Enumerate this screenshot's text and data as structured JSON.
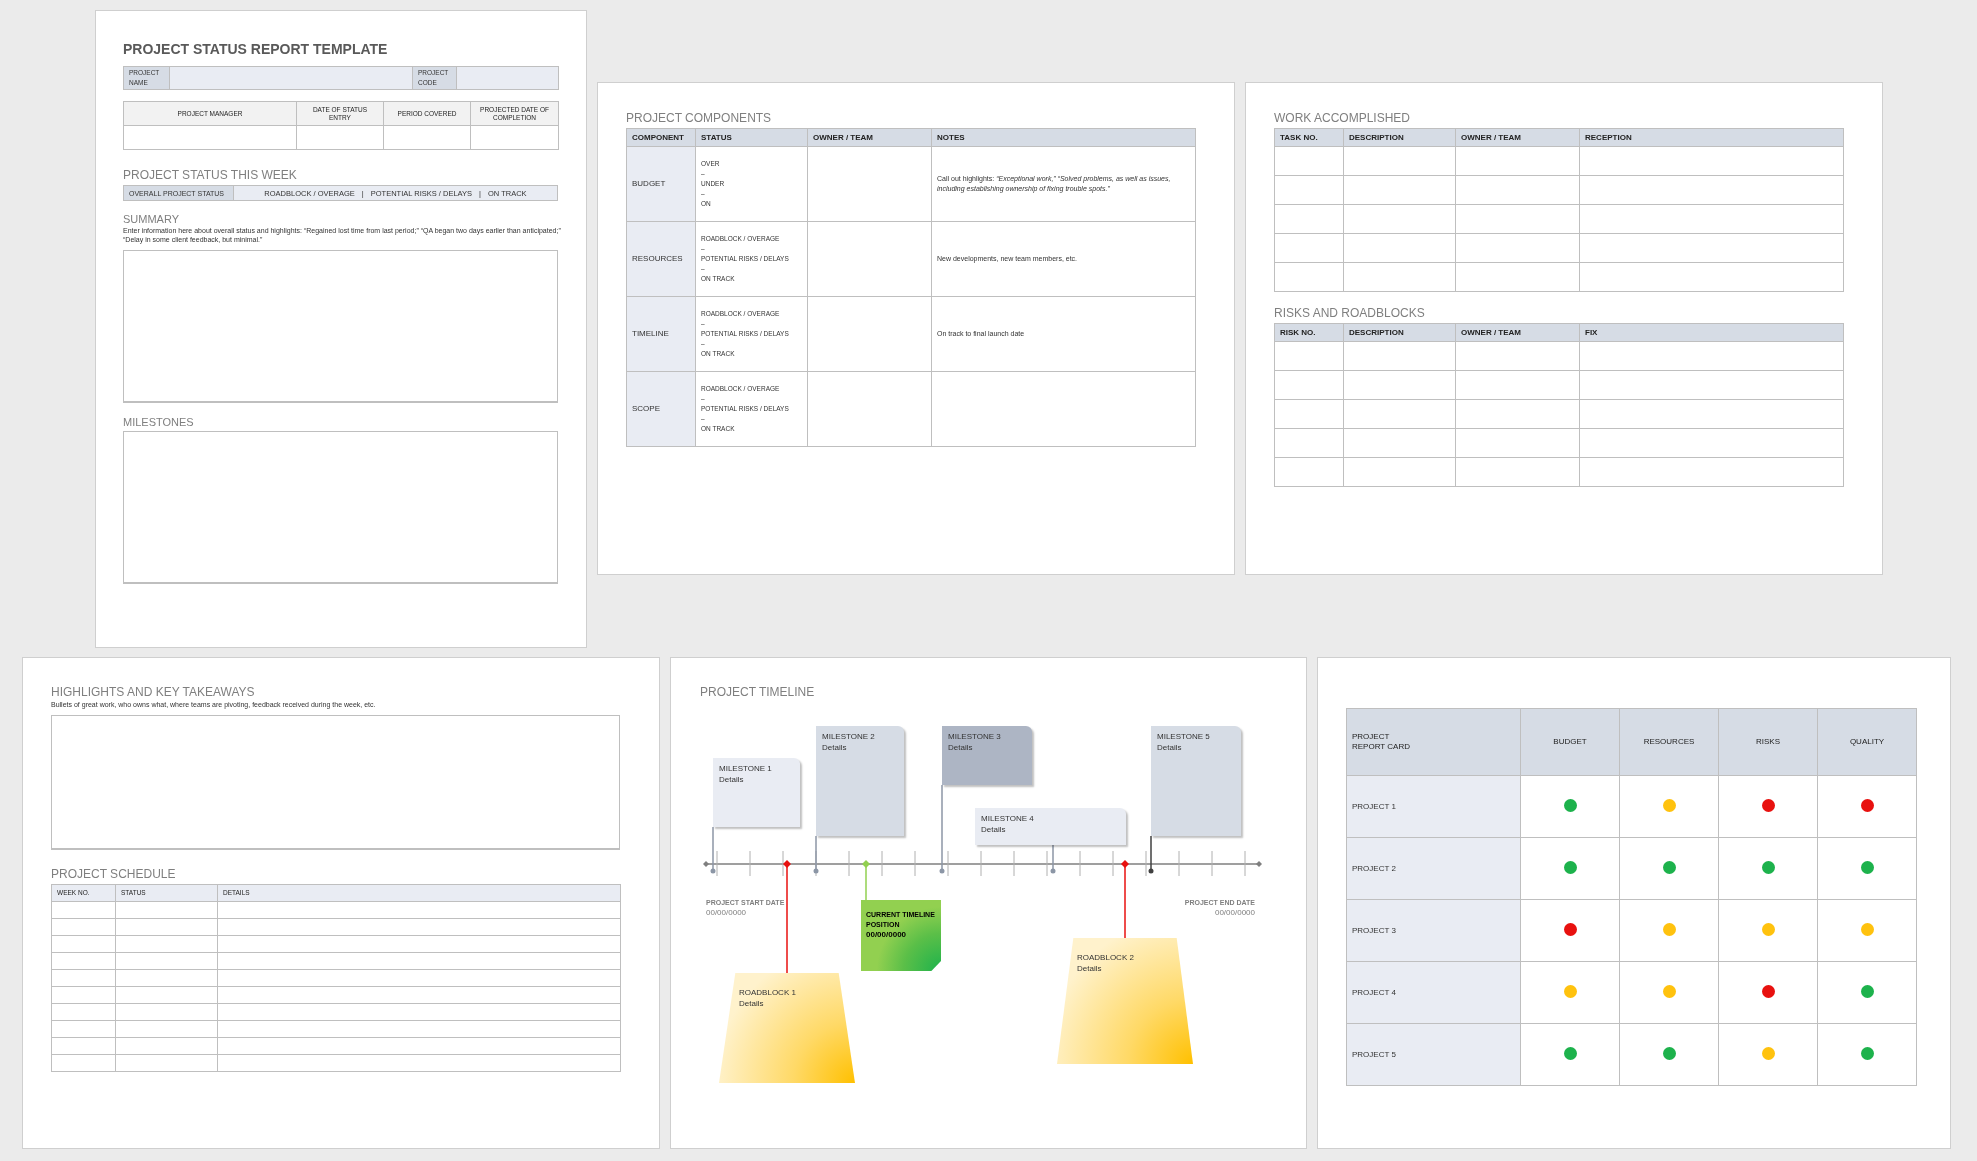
{
  "status_report": {
    "title": "PROJECT STATUS REPORT TEMPLATE",
    "project_fields": [
      "PROJECT NAME",
      "PROJECT CODE"
    ],
    "info_columns": [
      "PROJECT MANAGER",
      "DATE OF STATUS ENTRY",
      "PERIOD COVERED",
      "PROJECTED DATE OF COMPLETION"
    ],
    "status_heading": "PROJECT STATUS THIS WEEK",
    "overall_label": "OVERALL PROJECT STATUS",
    "status_options": [
      "ROADBLOCK / OVERAGE",
      "|",
      "POTENTIAL RISKS / DELAYS",
      "|",
      "ON TRACK"
    ],
    "summary_heading": "SUMMARY",
    "summary_hint": "Enter information here about overall status and highlights: “Regained lost time from last period;” “QA began two days earlier than anticipated;” “Delay in some client feedback, but minimal.”",
    "milestones_heading": "MILESTONES"
  },
  "components": {
    "heading": "PROJECT COMPONENTS",
    "columns": [
      "COMPONENT",
      "STATUS",
      "OWNER / TEAM",
      "NOTES"
    ],
    "rows": [
      {
        "component": "BUDGET",
        "status": [
          "OVER",
          "–",
          "UNDER",
          "–",
          "ON"
        ],
        "notes": "Call out highlights: *“Exceptional work,” “Solved problems, as well as issues, including establishing ownership of fixing trouble spots.”*"
      },
      {
        "component": "RESOURCES",
        "status": [
          "ROADBLOCK / OVERAGE",
          "–",
          "POTENTIAL RISKS / DELAYS",
          "–",
          "ON TRACK"
        ],
        "notes": "New developments, new team members, etc."
      },
      {
        "component": "TIMELINE",
        "status": [
          "ROADBLOCK / OVERAGE",
          "–",
          "POTENTIAL RISKS / DELAYS",
          "–",
          "ON TRACK"
        ],
        "notes": "On track to final launch date"
      },
      {
        "component": "SCOPE",
        "status": [
          "ROADBLOCK / OVERAGE",
          "–",
          "POTENTIAL RISKS / DELAYS",
          "–",
          "ON TRACK"
        ]
      }
    ]
  },
  "work_accomplished": {
    "heading": "WORK ACCOMPLISHED",
    "columns": [
      "TASK NO.",
      "DESCRIPTION",
      "OWNER / TEAM",
      "RECEPTION"
    ]
  },
  "risks": {
    "heading": "RISKS AND ROADBLOCKS",
    "columns": [
      "RISK NO.",
      "DESCRIPTION",
      "OWNER / TEAM",
      "FIX"
    ]
  },
  "highlights": {
    "heading": "HIGHLIGHTS AND KEY TAKEAWAYS",
    "hint": "Bullets of great work, who owns what, where teams are pivoting, feedback received during the week, etc."
  },
  "schedule": {
    "heading": "PROJECT SCHEDULE",
    "columns": [
      "WEEK NO.",
      "STATUS",
      "DETAILS"
    ]
  },
  "timeline": {
    "heading": "PROJECT TIMELINE",
    "milestones": [
      {
        "title": "MILESTONE 1",
        "details": "Details",
        "color": "#e9ecf3"
      },
      {
        "title": "MILESTONE 2",
        "details": "Details",
        "color": "#d6dce5"
      },
      {
        "title": "MILESTONE 3",
        "details": "Details",
        "color": "#adb5c4"
      },
      {
        "title": "MILESTONE 4",
        "details": "Details",
        "color": "#e9ecf3"
      },
      {
        "title": "MILESTONE 5",
        "details": "Details",
        "color": "#d6dce5"
      }
    ],
    "roadblocks": [
      {
        "title": "ROADBLOCK 1",
        "details": "Details"
      },
      {
        "title": "ROADBLOCK 2",
        "details": "Details"
      }
    ],
    "current": {
      "label": "CURRENT TIMELINE POSITION",
      "date": "00/00/0000"
    },
    "start": {
      "label": "PROJECT START DATE",
      "date": "00/00/0000"
    },
    "end": {
      "label": "PROJECT END DATE",
      "date": "00/00/0000"
    }
  },
  "report_card": {
    "corner": "PROJECT REPORT CARD",
    "columns": [
      "BUDGET",
      "RESOURCES",
      "RISKS",
      "QUALITY"
    ],
    "rows": [
      {
        "name": "PROJECT 1",
        "statuses": [
          {
            "color": "#1db24c"
          },
          {
            "color": "#ffc20e"
          },
          {
            "color": "#e8110f"
          },
          {
            "color": "#e8110f"
          }
        ]
      },
      {
        "name": "PROJECT 2",
        "statuses": [
          {
            "color": "#1db24c"
          },
          {
            "color": "#1db24c"
          },
          {
            "color": "#1db24c"
          },
          {
            "color": "#1db24c"
          }
        ]
      },
      {
        "name": "PROJECT 3",
        "statuses": [
          {
            "color": "#e8110f"
          },
          {
            "color": "#ffc20e"
          },
          {
            "color": "#ffc20e"
          },
          {
            "color": "#ffc20e"
          }
        ]
      },
      {
        "name": "PROJECT 4",
        "statuses": [
          {
            "color": "#ffc20e"
          },
          {
            "color": "#ffc20e"
          },
          {
            "color": "#e8110f"
          },
          {
            "color": "#1db24c"
          }
        ]
      },
      {
        "name": "PROJECT 5",
        "statuses": [
          {
            "color": "#1db24c"
          },
          {
            "color": "#1db24c"
          },
          {
            "color": "#ffc20e"
          },
          {
            "color": "#1db24c"
          }
        ]
      }
    ]
  }
}
